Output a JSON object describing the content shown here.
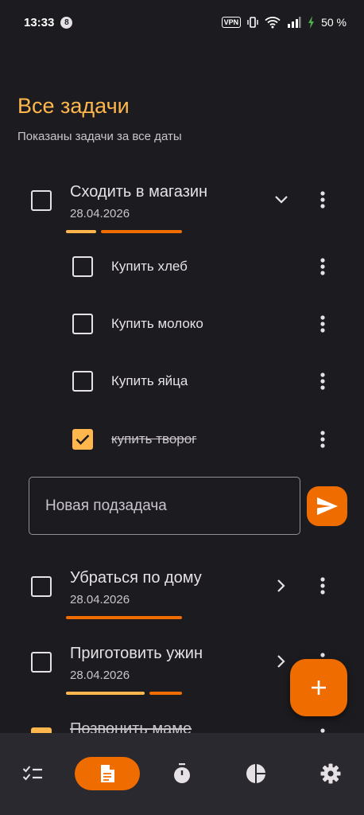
{
  "status_bar": {
    "time": "13:33",
    "notification_count": "8",
    "vpn_label": "VPN",
    "battery": "50 %"
  },
  "header": {
    "title": "Все задачи",
    "subtitle": "Показаны задачи за все даты"
  },
  "tasks": [
    {
      "title": "Сходить в магазин",
      "date": "28.04.2026",
      "expanded": true,
      "subtasks": [
        {
          "title": "Купить хлеб",
          "done": false
        },
        {
          "title": "Купить молоко",
          "done": false
        },
        {
          "title": "Купить яйца",
          "done": false
        },
        {
          "title": "купить творог",
          "done": true
        }
      ]
    },
    {
      "title": "Убраться по дому",
      "date": "28.04.2026",
      "expanded": false
    },
    {
      "title": "Приготовить ужин",
      "date": "28.04.2026",
      "expanded": false
    },
    {
      "title": "Позвонить маме",
      "done": true
    }
  ],
  "new_subtask": {
    "placeholder": "Новая подзадача"
  },
  "colors": {
    "accent": "#ef6c00",
    "accent_light": "#ffb74d",
    "background": "#1c1b1f",
    "nav_background": "#2b2930"
  },
  "bottom_nav": [
    {
      "icon": "checklist-icon",
      "active": false
    },
    {
      "icon": "document-icon",
      "active": true
    },
    {
      "icon": "timer-icon",
      "active": false
    },
    {
      "icon": "pie-chart-icon",
      "active": false
    },
    {
      "icon": "gear-icon",
      "active": false
    }
  ]
}
